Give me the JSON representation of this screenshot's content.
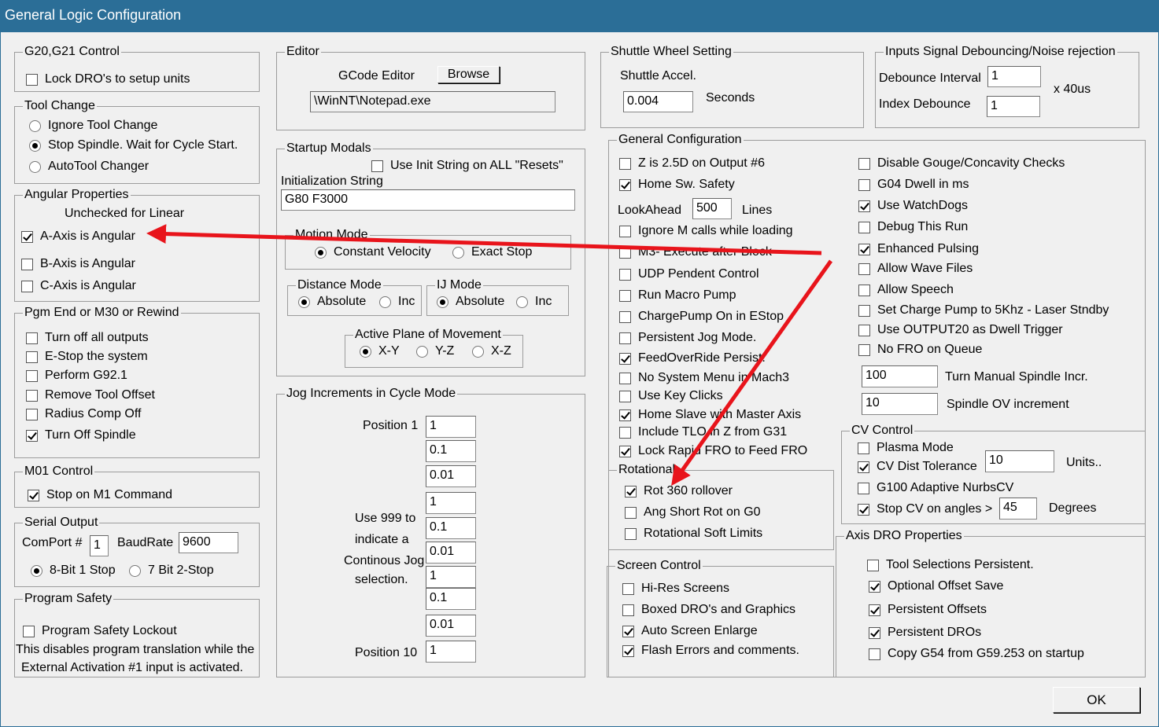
{
  "window": {
    "title": "General Logic Configuration"
  },
  "g20": {
    "legend": "G20,G21 Control",
    "lock_dro": {
      "label": "Lock DRO's to setup units",
      "checked": false
    }
  },
  "tool_change": {
    "legend": "Tool Change",
    "options": [
      {
        "label": "Ignore Tool Change",
        "selected": false
      },
      {
        "label": "Stop Spindle. Wait for Cycle Start.",
        "selected": true
      },
      {
        "label": "AutoTool Changer",
        "selected": false
      }
    ]
  },
  "angular": {
    "legend": "Angular Properties",
    "note": "Unchecked for Linear",
    "items": [
      {
        "label": "A-Axis is Angular",
        "checked": true
      },
      {
        "label": "B-Axis is Angular",
        "checked": false
      },
      {
        "label": "C-Axis is Angular",
        "checked": false
      }
    ]
  },
  "pgm_end": {
    "legend": "Pgm End or M30 or Rewind",
    "items": [
      {
        "label": "Turn off all outputs",
        "checked": false
      },
      {
        "label": "E-Stop the system",
        "checked": false
      },
      {
        "label": "Perform G92.1",
        "checked": false
      },
      {
        "label": "Remove Tool Offset",
        "checked": false
      },
      {
        "label": "Radius Comp Off",
        "checked": false
      },
      {
        "label": "Turn Off Spindle",
        "checked": true
      }
    ]
  },
  "m01": {
    "legend": "M01 Control",
    "stop_m1": {
      "label": "Stop on M1 Command",
      "checked": true
    }
  },
  "serial": {
    "legend": "Serial Output",
    "comport_label": "ComPort #",
    "comport": "1",
    "baud_label": "BaudRate",
    "baud": "9600",
    "options": [
      {
        "label": "8-Bit 1 Stop",
        "selected": true
      },
      {
        "label": "7 Bit 2-Stop",
        "selected": false
      }
    ]
  },
  "safety": {
    "legend": "Program Safety",
    "lockout": {
      "label": "Program Safety Lockout",
      "checked": false
    },
    "note1": "This disables program translation while the",
    "note2": "External Activation #1 input is activated."
  },
  "editor": {
    "legend": "Editor",
    "label": "GCode Editor",
    "browse": "Browse",
    "path": "\\WinNT\\Notepad.exe"
  },
  "startup": {
    "legend": "Startup Modals",
    "use_init": {
      "label": "Use Init String on ALL  \"Resets\"",
      "checked": false
    },
    "init_label": "Initialization String",
    "init_value": "G80 F3000",
    "motion": {
      "legend": "Motion Mode",
      "options": [
        {
          "label": "Constant Velocity",
          "selected": true
        },
        {
          "label": "Exact Stop",
          "selected": false
        }
      ]
    },
    "distance": {
      "legend": "Distance Mode",
      "options": [
        {
          "label": "Absolute",
          "selected": true
        },
        {
          "label": "Inc",
          "selected": false
        }
      ]
    },
    "ij": {
      "legend": "IJ Mode",
      "options": [
        {
          "label": "Absolute",
          "selected": true
        },
        {
          "label": "Inc",
          "selected": false
        }
      ]
    },
    "plane": {
      "legend": "Active Plane of Movement",
      "options": [
        {
          "label": "X-Y",
          "selected": true
        },
        {
          "label": "Y-Z",
          "selected": false
        },
        {
          "label": "X-Z",
          "selected": false
        }
      ]
    }
  },
  "jog": {
    "legend": "Jog Increments in Cycle Mode",
    "pos1": "Position 1",
    "pos10": "Position 10",
    "note": [
      "Use 999 to",
      "indicate a",
      "Continous Jog",
      "selection."
    ],
    "values": [
      "1",
      "0.1",
      "0.01",
      "1",
      "0.1",
      "0.01",
      "1",
      "0.1",
      "0.01",
      "1"
    ]
  },
  "shuttle": {
    "legend": "Shuttle Wheel Setting",
    "accel_label": "Shuttle Accel.",
    "value": "0.004",
    "unit": "Seconds"
  },
  "inputs": {
    "legend": "Inputs Signal Debouncing/Noise rejection",
    "debounce_label": "Debounce Interval",
    "debounce": "1",
    "index_label": "Index Debounce",
    "index": "1",
    "unit": "x 40us"
  },
  "general": {
    "legend": "General Configuration",
    "left_top": [
      {
        "label": "Z is 2.5D on Output #6",
        "checked": false
      },
      {
        "label": "Home Sw. Safety",
        "checked": true
      }
    ],
    "lookahead_label": "LookAhead",
    "lookahead": "500",
    "lines": "Lines",
    "left": [
      {
        "label": "Ignore M calls while loading",
        "checked": false
      },
      {
        "label": "M3- Execute after Block",
        "checked": false
      },
      {
        "label": "UDP Pendent Control",
        "checked": false
      },
      {
        "label": "Run Macro Pump",
        "checked": false
      },
      {
        "label": "ChargePump On in EStop",
        "checked": false
      },
      {
        "label": "Persistent Jog Mode.",
        "checked": false
      },
      {
        "label": "FeedOverRide Persist.",
        "checked": true
      },
      {
        "label": "No System Menu in Mach3",
        "checked": false
      },
      {
        "label": "Use Key Clicks",
        "checked": false
      },
      {
        "label": "Home Slave with Master Axis",
        "checked": true
      },
      {
        "label": "Include TLO in Z from G31",
        "checked": false
      },
      {
        "label": "Lock Rapid FRO to Feed FRO",
        "checked": true
      }
    ],
    "right": [
      {
        "label": "Disable Gouge/Concavity Checks",
        "checked": false
      },
      {
        "label": "G04 Dwell in ms",
        "checked": false
      },
      {
        "label": "Use WatchDogs",
        "checked": true
      },
      {
        "label": "Debug This Run",
        "checked": false
      },
      {
        "label": "Enhanced Pulsing",
        "checked": true
      },
      {
        "label": "Allow Wave Files",
        "checked": false
      },
      {
        "label": "Allow Speech",
        "checked": false
      },
      {
        "label": "Set Charge Pump to 5Khz  - Laser Stndby",
        "checked": false
      },
      {
        "label": "Use OUTPUT20 as Dwell Trigger",
        "checked": false
      },
      {
        "label": "No FRO on Queue",
        "checked": false
      }
    ],
    "spindle_incr": "100",
    "spindle_incr_label": "Turn Manual Spindle Incr.",
    "spindle_ov": "10",
    "spindle_ov_label": "Spindle OV increment"
  },
  "rotational": {
    "legend": "Rotational",
    "items": [
      {
        "label": "Rot 360 rollover",
        "checked": true
      },
      {
        "label": "Ang Short Rot on G0",
        "checked": false
      },
      {
        "label": "Rotational Soft Limits",
        "checked": false
      }
    ]
  },
  "cv": {
    "legend": "CV Control",
    "plasma": {
      "label": "Plasma Mode",
      "checked": false
    },
    "dist": {
      "label": "CV Dist Tolerance",
      "checked": true,
      "value": "10",
      "unit": "Units.."
    },
    "g100": {
      "label": "G100 Adaptive NurbsCV",
      "checked": false
    },
    "angles": {
      "label": "Stop CV on angles >",
      "checked": true,
      "value": "45",
      "unit": "Degrees"
    }
  },
  "screen": {
    "legend": "Screen Control",
    "items": [
      {
        "label": "Hi-Res Screens",
        "checked": false
      },
      {
        "label": "Boxed DRO's and Graphics",
        "checked": false
      },
      {
        "label": "Auto Screen Enlarge",
        "checked": true
      },
      {
        "label": "Flash Errors and comments.",
        "checked": true
      }
    ]
  },
  "axis_dro": {
    "legend": "Axis DRO Properties",
    "items": [
      {
        "label": "Tool Selections Persistent.",
        "checked": false
      },
      {
        "label": "Optional Offset Save",
        "checked": true
      },
      {
        "label": "Persistent Offsets",
        "checked": true
      },
      {
        "label": "Persistent DROs",
        "checked": true
      },
      {
        "label": "Copy G54 from G59.253 on startup",
        "checked": false
      }
    ]
  },
  "ok": "OK",
  "colors": {
    "title_bar": "#2b6e97",
    "arrow": "#e8141b",
    "dialog": "#f0f0f0"
  }
}
